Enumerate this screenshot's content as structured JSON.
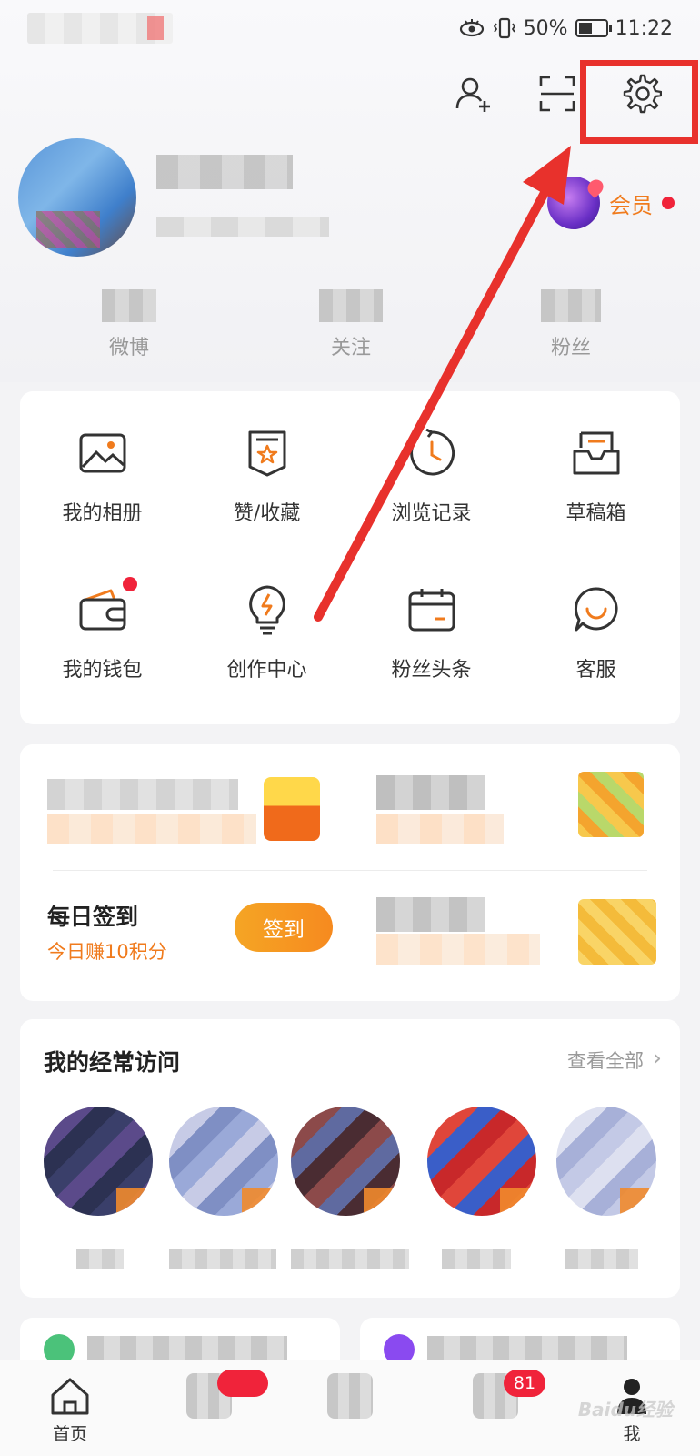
{
  "status_bar": {
    "battery": "50%",
    "time": "11:22"
  },
  "profile": {
    "member_label": "会员"
  },
  "stats": [
    {
      "label": "微博"
    },
    {
      "label": "关注"
    },
    {
      "label": "粉丝"
    }
  ],
  "shortcuts": [
    {
      "label": "我的相册",
      "icon": "photo-album-icon"
    },
    {
      "label": "赞/收藏",
      "icon": "favorites-icon"
    },
    {
      "label": "浏览记录",
      "icon": "history-icon"
    },
    {
      "label": "草稿箱",
      "icon": "drafts-icon"
    },
    {
      "label": "我的钱包",
      "icon": "wallet-icon",
      "badge_dot": true
    },
    {
      "label": "创作中心",
      "icon": "creator-bulb-icon"
    },
    {
      "label": "粉丝头条",
      "icon": "fan-headline-icon"
    },
    {
      "label": "客服",
      "icon": "customer-service-icon"
    }
  ],
  "tasks": {
    "checkin_title": "每日签到",
    "checkin_subtitle": "今日赚10积分",
    "checkin_button": "签到"
  },
  "frequent_visits": {
    "title": "我的经常访问",
    "view_all": "查看全部"
  },
  "bottom_nav": [
    {
      "label": "首页",
      "icon": "home-icon"
    },
    {
      "label": "",
      "icon": "video-icon"
    },
    {
      "label": "",
      "icon": "discover-icon"
    },
    {
      "label": "",
      "icon": "message-icon",
      "badge": "81"
    },
    {
      "label": "我",
      "icon": "me-icon"
    }
  ],
  "watermark": "Baidu经验",
  "colors": {
    "accent_orange": "#f07b1d",
    "alert_red": "#f0233a",
    "annotation_red": "#e8312c"
  }
}
